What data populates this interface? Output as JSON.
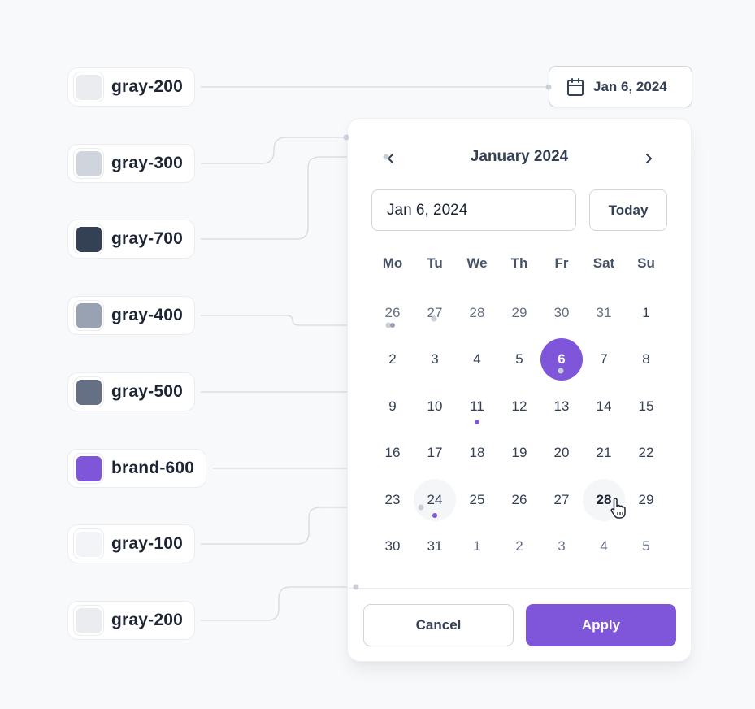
{
  "tokens": [
    {
      "label": "gray-200",
      "color": "#eaecf0"
    },
    {
      "label": "gray-300",
      "color": "#d0d5dd"
    },
    {
      "label": "gray-700",
      "color": "#344054"
    },
    {
      "label": "gray-400",
      "color": "#98a2b3"
    },
    {
      "label": "gray-500",
      "color": "#667085"
    },
    {
      "label": "brand-600",
      "color": "#7f56d9"
    },
    {
      "label": "gray-100",
      "color": "#f2f4f7"
    },
    {
      "label": "gray-200",
      "color": "#eaecf0"
    }
  ],
  "trigger": {
    "icon": "calendar-icon",
    "label": "Jan 6, 2024"
  },
  "calendar": {
    "month_title": "January 2024",
    "prev_icon": "chevron-left-icon",
    "next_icon": "chevron-right-icon",
    "date_input_value": "Jan 6, 2024",
    "today_label": "Today",
    "weekdays": [
      "Mo",
      "Tu",
      "We",
      "Th",
      "Fr",
      "Sat",
      "Su"
    ],
    "weeks": [
      [
        {
          "d": "26",
          "muted": true
        },
        {
          "d": "27",
          "muted": true
        },
        {
          "d": "28",
          "muted": true
        },
        {
          "d": "29",
          "muted": true
        },
        {
          "d": "30",
          "muted": true
        },
        {
          "d": "31",
          "muted": true
        },
        {
          "d": "1"
        }
      ],
      [
        {
          "d": "2"
        },
        {
          "d": "3"
        },
        {
          "d": "4"
        },
        {
          "d": "5"
        },
        {
          "d": "6",
          "selected": true
        },
        {
          "d": "7"
        },
        {
          "d": "8"
        }
      ],
      [
        {
          "d": "9"
        },
        {
          "d": "10"
        },
        {
          "d": "11",
          "dot": true
        },
        {
          "d": "12"
        },
        {
          "d": "13"
        },
        {
          "d": "14"
        },
        {
          "d": "15"
        }
      ],
      [
        {
          "d": "16"
        },
        {
          "d": "17"
        },
        {
          "d": "18"
        },
        {
          "d": "19"
        },
        {
          "d": "20"
        },
        {
          "d": "21"
        },
        {
          "d": "22"
        }
      ],
      [
        {
          "d": "23"
        },
        {
          "d": "24",
          "today": true,
          "dot": true
        },
        {
          "d": "25"
        },
        {
          "d": "26"
        },
        {
          "d": "27"
        },
        {
          "d": "28",
          "hover": true
        },
        {
          "d": "29"
        }
      ],
      [
        {
          "d": "30"
        },
        {
          "d": "31"
        },
        {
          "d": "1",
          "muted": true
        },
        {
          "d": "2",
          "muted": true
        },
        {
          "d": "3",
          "muted": true
        },
        {
          "d": "4",
          "muted": true
        },
        {
          "d": "5",
          "muted": true
        }
      ]
    ],
    "cancel_label": "Cancel",
    "apply_label": "Apply"
  },
  "colors": {
    "brand": "#7f56d9",
    "connector": "#d0d5dd",
    "background": "#f8f9fb"
  }
}
